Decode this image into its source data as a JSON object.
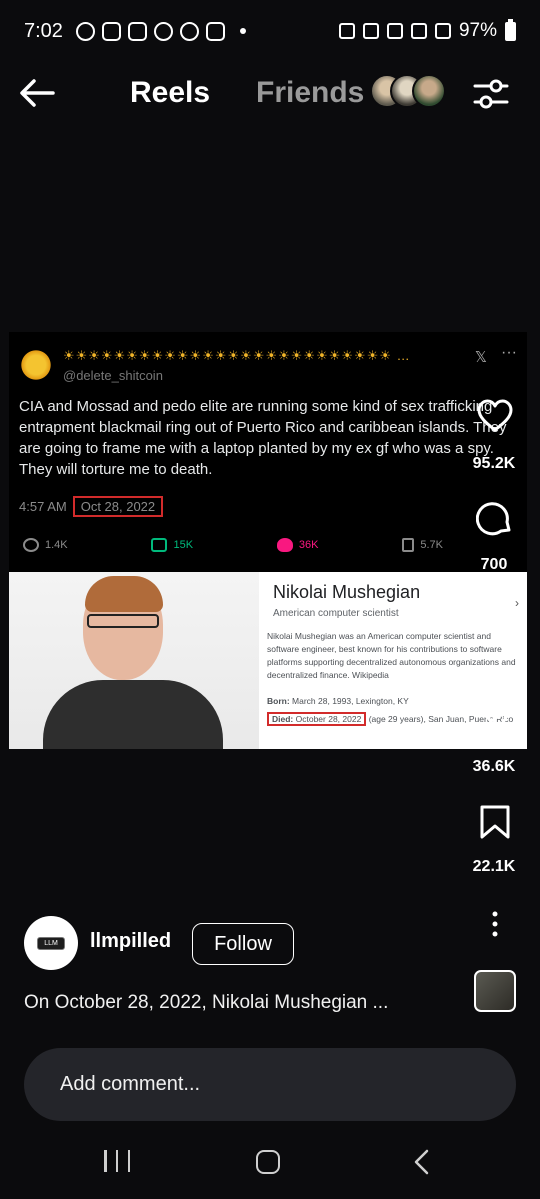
{
  "status_bar": {
    "time": "7:02",
    "battery": "97%"
  },
  "header": {
    "tab_reels": "Reels",
    "tab_friends": "Friends"
  },
  "tweet": {
    "handle": "@delete_shitcoin",
    "text": "CIA and Mossad and pedo elite are running some kind of sex trafficking entrapment blackmail ring out of Puerto Rico and caribbean islands. They are going to frame me with a laptop planted by my ex gf who was a spy. They will torture me to death.",
    "time": "4:57 AM",
    "date": "Oct 28, 2022",
    "replies": "1.4K",
    "retweets": "15K",
    "likes": "36K",
    "bookmarks": "5.7K"
  },
  "wiki": {
    "name": "Nikolai Mushegian",
    "role": "American computer scientist",
    "description": "Nikolai Mushegian was an American computer scientist and software engineer, best known for his contributions to software platforms supporting decentralized autonomous organizations and decentralized finance. Wikipedia",
    "born_label": "Born:",
    "born_value": "March 28, 1993, Lexington, KY",
    "died_label": "Died:",
    "died_date": "October 28, 2022",
    "died_rest": "(age 29 years), San Juan, Puerto Rico"
  },
  "rail": {
    "likes": "95.2K",
    "comments": "700",
    "shares": "36.6K",
    "saves": "22.1K"
  },
  "post": {
    "avatar_label": "LLM",
    "username": "llmpilled",
    "follow_label": "Follow",
    "caption": "On October 28, 2022, Nikolai Mushegian ..."
  },
  "comment": {
    "placeholder": "Add comment..."
  },
  "colors": {
    "background": "#0b0b0d",
    "highlight_box": "#d22b2b",
    "like_pink": "#f91880",
    "retweet_green": "#00ba7c"
  }
}
